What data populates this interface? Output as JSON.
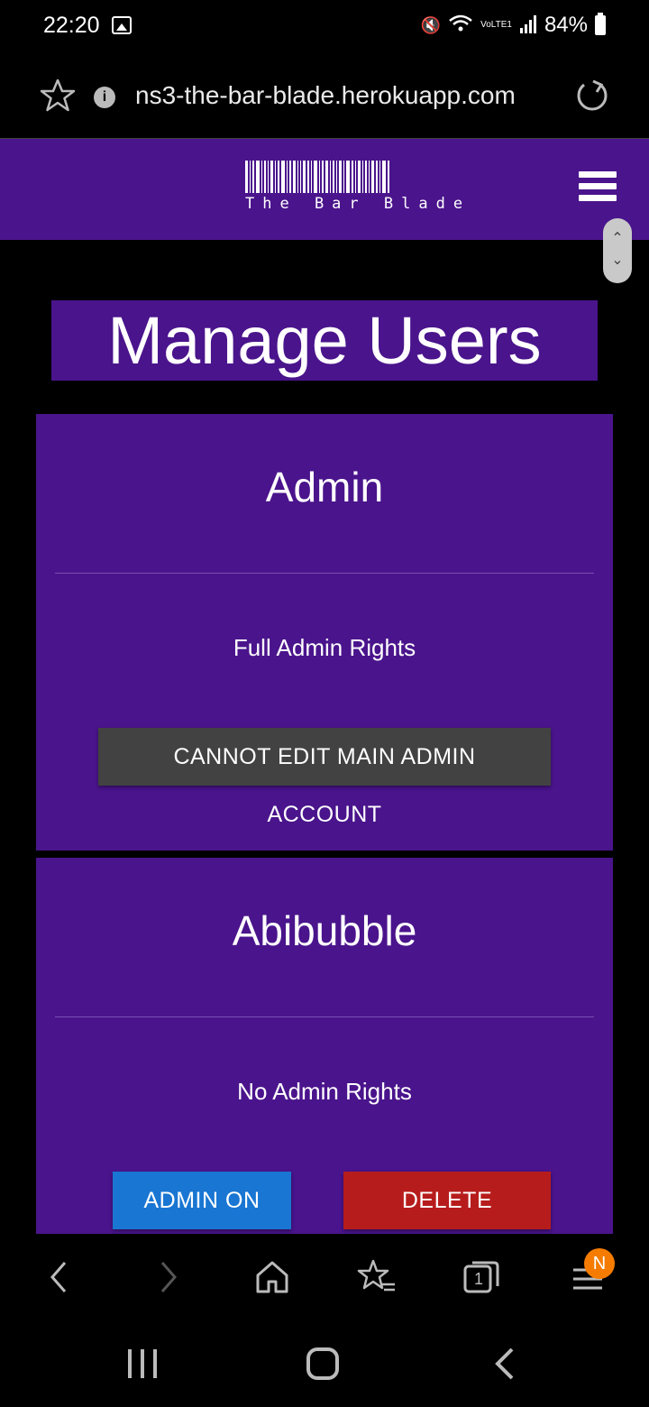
{
  "status_bar": {
    "time": "22:20",
    "signal_label": "VoLTE1",
    "battery": "84%"
  },
  "browser": {
    "url": "ns3-the-bar-blade.herokuapp.com",
    "tab_count": "1",
    "menu_badge": "N"
  },
  "site": {
    "logo_text": "The Bar Blade"
  },
  "main": {
    "page_title": "Manage Users",
    "users": [
      {
        "name": "Admin",
        "rights": "Full Admin Rights",
        "button_label": "CANNOT EDIT MAIN ADMIN",
        "button_label_line2": "ACCOUNT"
      },
      {
        "name": "Abibubble",
        "rights": "No Admin Rights",
        "admin_button_label": "ADMIN ON",
        "delete_button_label": "DELETE"
      }
    ]
  },
  "colors": {
    "brand_purple": "#4a148c",
    "admin_on_blue": "#1976d2",
    "delete_red": "#b71c1c",
    "disabled_grey": "#424242",
    "badge_orange": "#f57c00"
  }
}
